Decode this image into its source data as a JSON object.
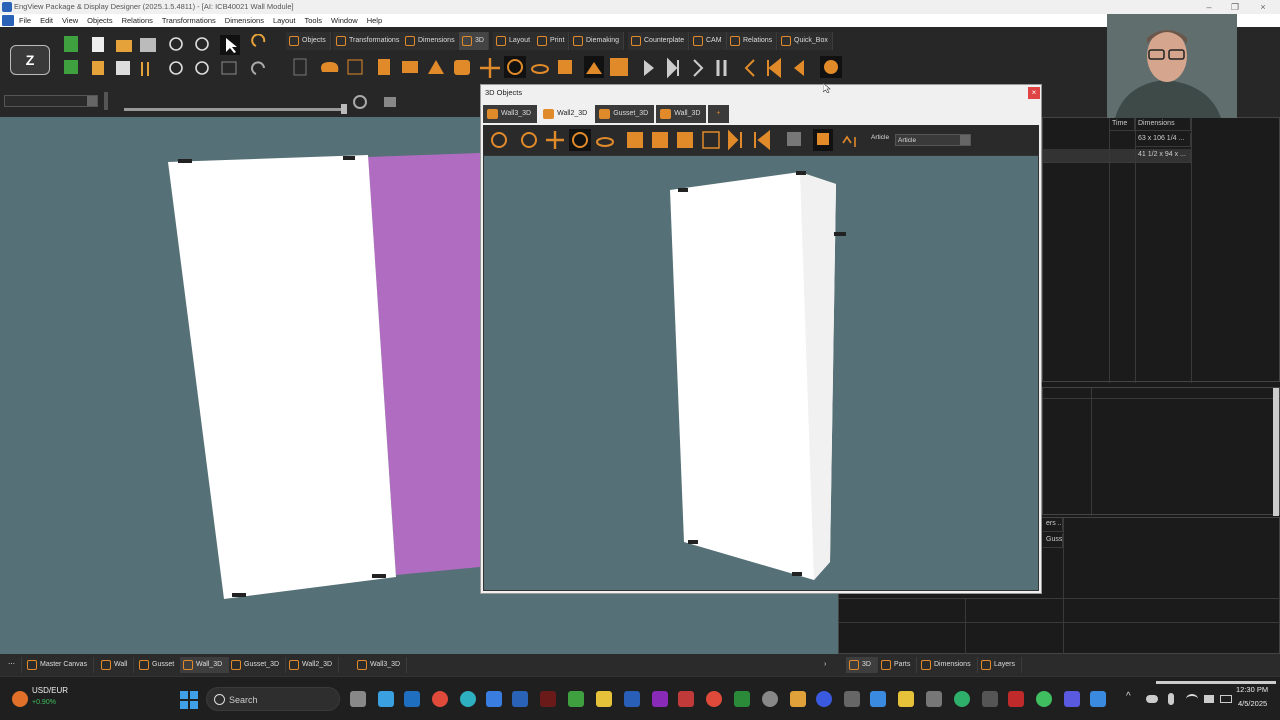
{
  "window": {
    "title": "EngView Package & Display Designer (2025.1.5.4811) - [AI: ICB40021 Wall Module]"
  },
  "menu": [
    "File",
    "Edit",
    "View",
    "Objects",
    "Relations",
    "Transformations",
    "Dimensions",
    "Layout",
    "Tools",
    "Window",
    "Help"
  ],
  "toolbar_tabs": [
    "Objects",
    "Transformations",
    "Dimensions",
    "3D",
    "Layout",
    "Print",
    "Diemaking",
    "Counterplate",
    "CAM",
    "Relations",
    "Quick_Box"
  ],
  "dialog": {
    "title": "3D Objects",
    "close": "×",
    "tabs": [
      "Wall3_3D",
      "Wall2_3D",
      "Gusset_3D",
      "Wall_3D"
    ],
    "add_tab": "+",
    "article_label": "Article",
    "article_value": "Article"
  },
  "right_panel": {
    "headers": [
      "Time",
      "Dimensions"
    ],
    "rows": [
      {
        "dimensions": "63 x 106 1/4 ..."
      },
      {
        "dimensions": "41 1/2 x 94 x ..."
      }
    ],
    "lower_header": "ers ...",
    "lower_row": "Guss..."
  },
  "bottom_tabs": [
    "Master Canvas",
    "Wall",
    "Gusset",
    "Wall_3D",
    "Gusset_3D",
    "Wall2_3D",
    "Wall3_3D"
  ],
  "bottom_tabs_right": [
    "3D",
    "Parts",
    "Dimensions",
    "Layers"
  ],
  "taskbar": {
    "stock_name": "USD/EUR",
    "stock_change": "+0.90%",
    "search_placeholder": "Search",
    "time": "12:30 PM",
    "date": "4/5/2025"
  },
  "colors": {
    "accent": "#e08a2a",
    "canvas": "#557076",
    "magenta_panel": "#b06cc0",
    "up": "#3fbf5f"
  }
}
